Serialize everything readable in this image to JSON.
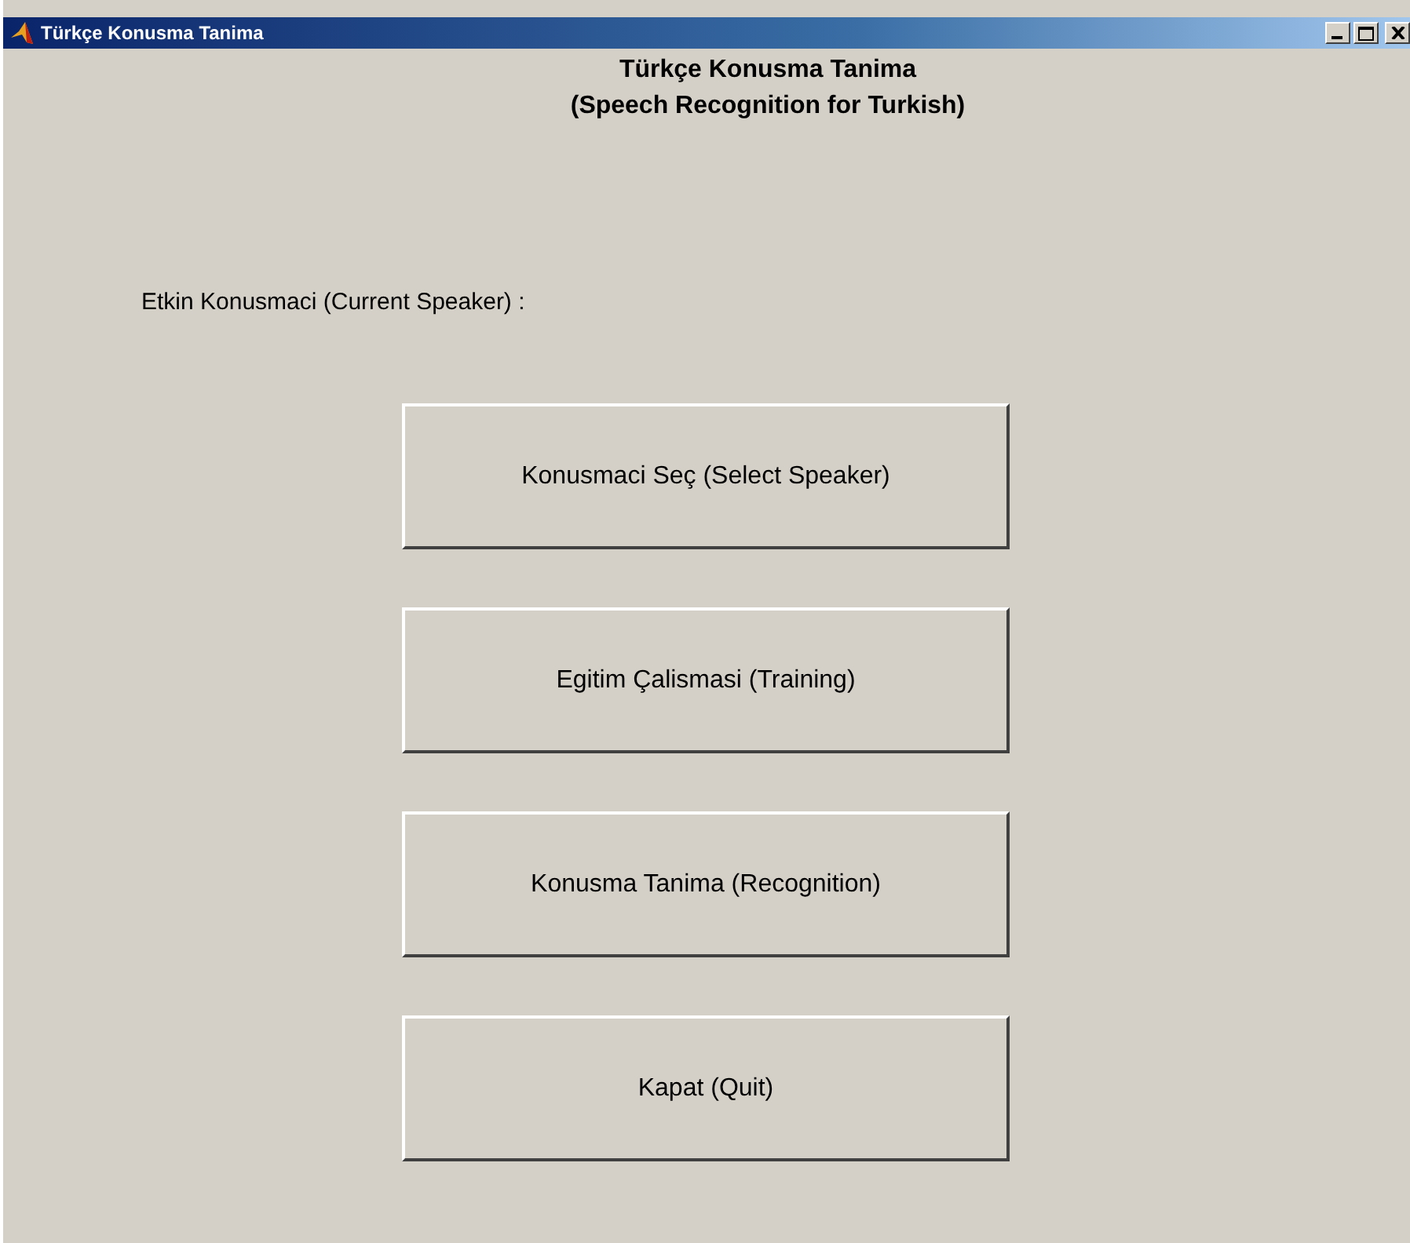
{
  "window": {
    "title": "Türkçe Konusma Tanima"
  },
  "heading": [
    "Türkçe Konusma Tanima",
    "(Speech Recognition for Turkish)"
  ],
  "speaker_label": "Etkin Konusmaci (Current Speaker) :",
  "buttons": [
    "Konusmaci Seç (Select Speaker)",
    "Egitim Çalismasi (Training)",
    "Konusma Tanima (Recognition)",
    "Kapat (Quit)"
  ]
}
